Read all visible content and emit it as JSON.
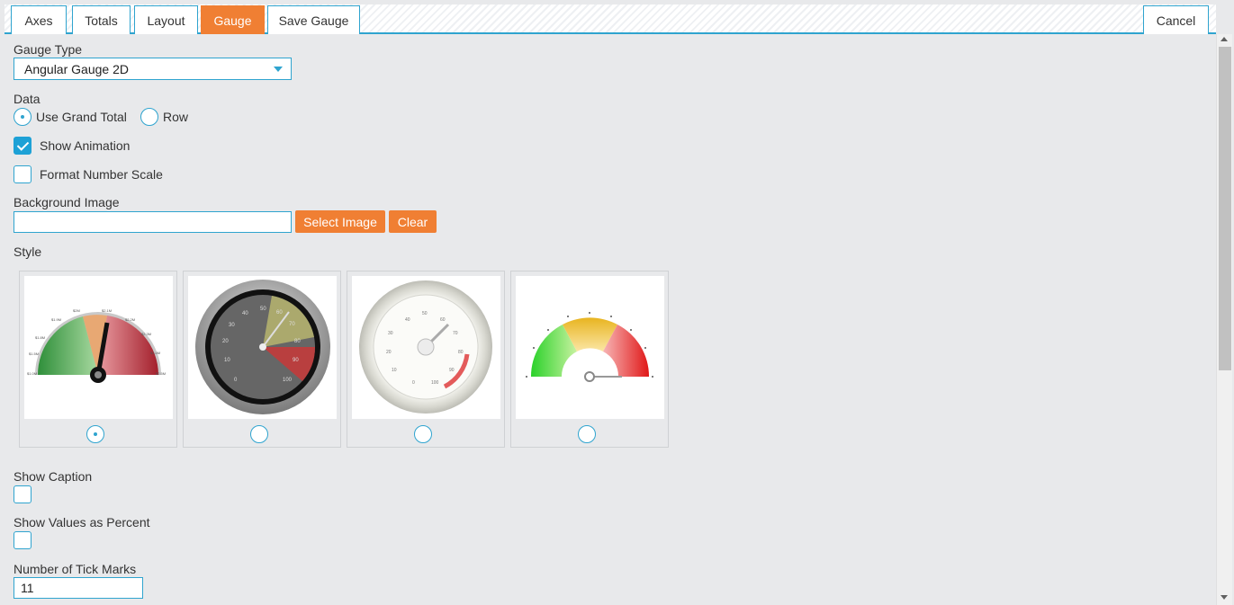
{
  "tabs": [
    {
      "label": "Axes",
      "active": false
    },
    {
      "label": "Totals",
      "active": false
    },
    {
      "label": "Layout",
      "active": false
    },
    {
      "label": "Gauge",
      "active": true
    },
    {
      "label": "Save Gauge",
      "active": false
    }
  ],
  "cancel_label": "Cancel",
  "gauge_type": {
    "label": "Gauge Type",
    "value": "Angular Gauge 2D"
  },
  "data_section": {
    "label": "Data",
    "options": [
      {
        "label": "Use Grand Total",
        "selected": true
      },
      {
        "label": "Row",
        "selected": false
      }
    ]
  },
  "show_animation": {
    "label": "Show Animation",
    "checked": true
  },
  "format_number_scale": {
    "label": "Format Number Scale",
    "checked": false
  },
  "background_image": {
    "label": "Background Image",
    "value": "",
    "select_label": "Select Image",
    "clear_label": "Clear"
  },
  "style": {
    "label": "Style",
    "options": [
      {
        "name": "half-dial-red-green-gauge",
        "selected": true,
        "ticks": [
          "$1.0M",
          "$1.5M",
          "$1.8M",
          "$1.9M",
          "$2M",
          "$2.1M",
          "$2.2M",
          "$2.3M",
          "$2.4M",
          "$2.5M"
        ]
      },
      {
        "name": "dark-round-gauge",
        "selected": false,
        "ticks": [
          "0",
          "10",
          "20",
          "30",
          "40",
          "50",
          "60",
          "70",
          "80",
          "90",
          "100"
        ]
      },
      {
        "name": "white-round-gauge",
        "selected": false,
        "ticks": [
          "0",
          "10",
          "20",
          "30",
          "40",
          "50",
          "60",
          "70",
          "80",
          "90",
          "100"
        ]
      },
      {
        "name": "colored-half-gauge",
        "selected": false
      }
    ]
  },
  "show_caption": {
    "label": "Show Caption",
    "checked": false
  },
  "show_values_percent": {
    "label": "Show Values as Percent",
    "checked": false
  },
  "tick_marks": {
    "label": "Number of Tick Marks",
    "value": "11"
  },
  "colors": {
    "accent": "#2fa4cf",
    "orange": "#f07f33",
    "background": "#e8e9eb"
  }
}
